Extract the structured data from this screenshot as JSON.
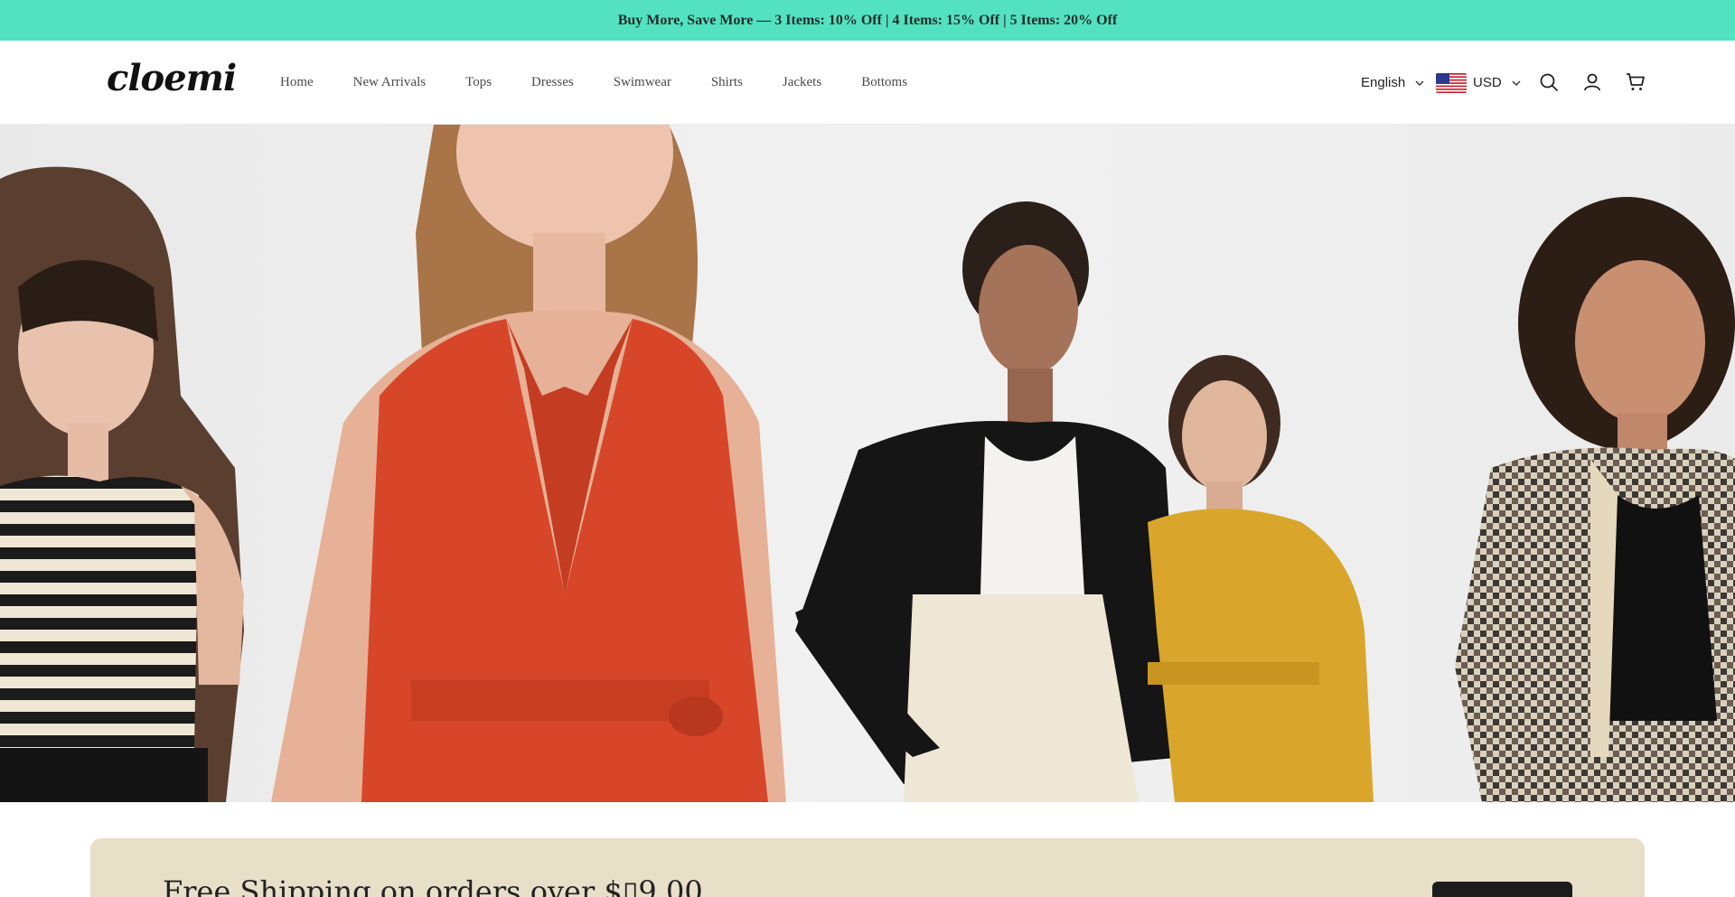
{
  "announcement": "Buy More, Save More — 3 Items: 10% Off | 4 Items: 15% Off | 5 Items: 20% Off",
  "logo": "cloemi",
  "nav": [
    "Home",
    "New Arrivals",
    "Tops",
    "Dresses",
    "Swimwear",
    "Shirts",
    "Jackets",
    "Bottoms"
  ],
  "language": "English",
  "currency": "USD",
  "icons": {
    "search": "search-icon",
    "account": "user-icon",
    "cart": "cart-icon",
    "flag": "us-flag-icon"
  },
  "shipping_banner": "Free Shipping on orders over $▯9.00",
  "colors": {
    "announcement_bg": "#53e2c1",
    "banner_bg": "#e8dfc9",
    "button_bg": "#1c1c1c"
  }
}
